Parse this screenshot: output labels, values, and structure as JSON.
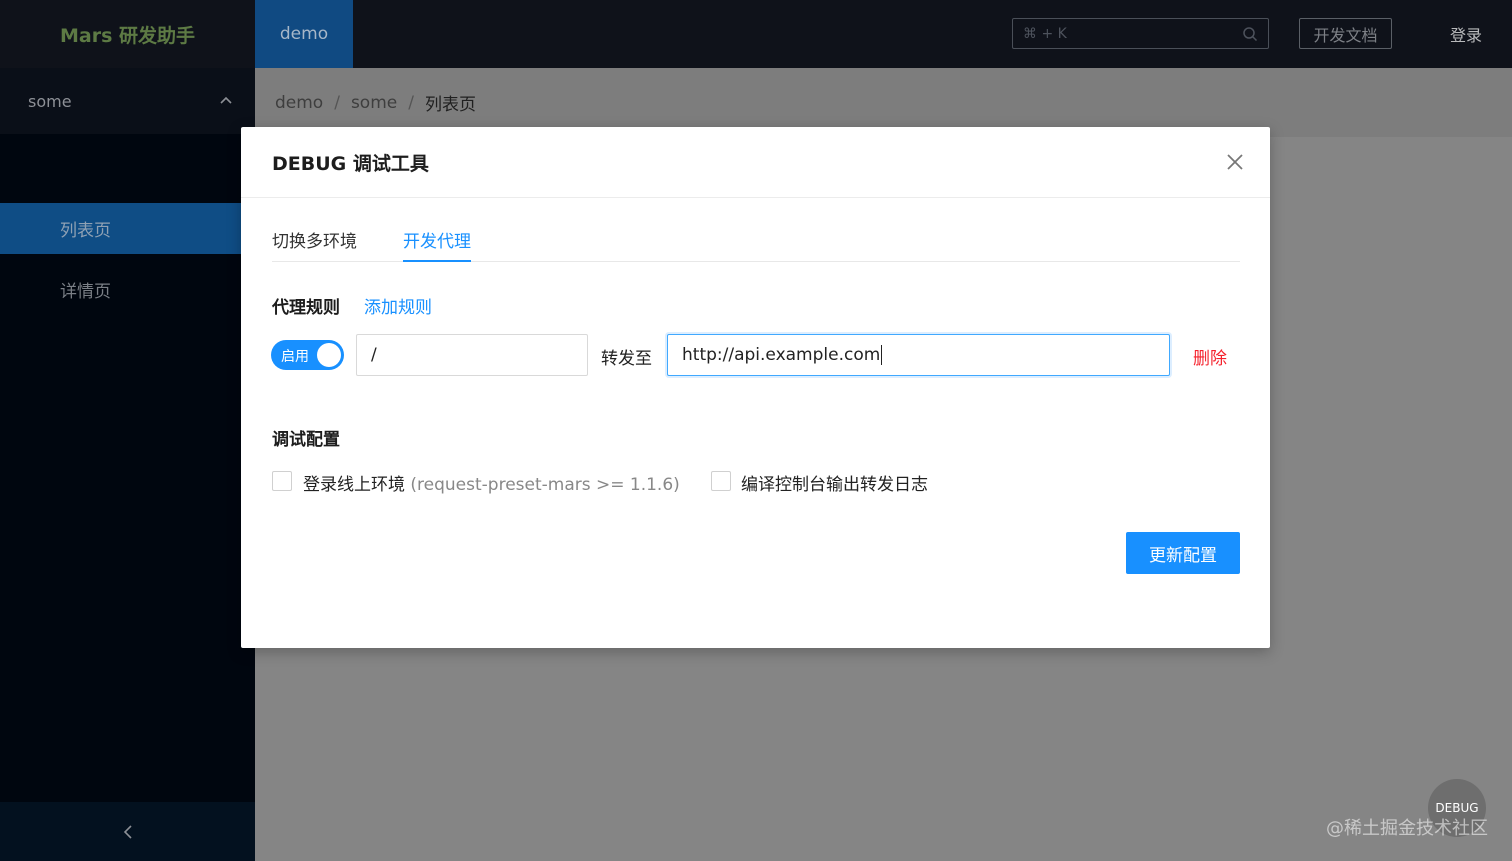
{
  "header": {
    "logo": "Mars 研发助手",
    "project_tab": "demo",
    "search_placeholder": "⌘ + K",
    "docs_button": "开发文档",
    "login": "登录"
  },
  "sidebar": {
    "group_title": "some",
    "items": [
      {
        "label": "列表页",
        "active": true
      },
      {
        "label": "详情页",
        "active": false
      }
    ]
  },
  "breadcrumb": {
    "items": [
      "demo",
      "some",
      "列表页"
    ],
    "separator": "/"
  },
  "modal": {
    "title": "DEBUG 调试工具",
    "tabs": [
      {
        "label": "切换多环境",
        "active": false
      },
      {
        "label": "开发代理",
        "active": true
      }
    ],
    "proxy": {
      "section_label": "代理规则",
      "add_rule": "添加规则",
      "toggle_label": "启用",
      "path_value": "/",
      "forward_label": "转发至",
      "url_value": "http://api.example.com",
      "delete_label": "删除"
    },
    "debug_config": {
      "section_label": "调试配置",
      "checkbox1_label": "登录线上环境",
      "checkbox1_hint": "(request-preset-mars >= 1.1.6)",
      "checkbox2_label": "编译控制台输出转发日志"
    },
    "submit_button": "更新配置"
  },
  "debug_fab": "DEBUG",
  "watermark": "@稀土掘金技术社区",
  "colors": {
    "primary": "#1890ff",
    "danger": "#f5222d",
    "sidebar_bg": "#001529"
  }
}
